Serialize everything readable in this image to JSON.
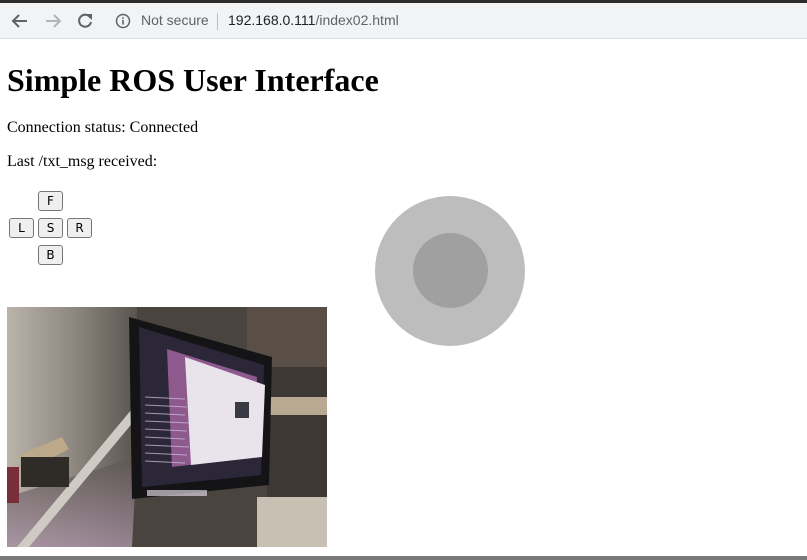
{
  "browser": {
    "security_label": "Not secure",
    "url_host": "192.168.0.111",
    "url_path": "/index02.html"
  },
  "page": {
    "title": "Simple ROS User Interface",
    "status_line": "Connection status: Connected",
    "msg_line": "Last /txt_msg received:"
  },
  "controls": {
    "forward": "F",
    "left": "L",
    "stop": "S",
    "right": "R",
    "back": "B"
  },
  "colors": {
    "joystick_base": "#bdbdbd",
    "joystick_knob": "#a0a0a0"
  }
}
